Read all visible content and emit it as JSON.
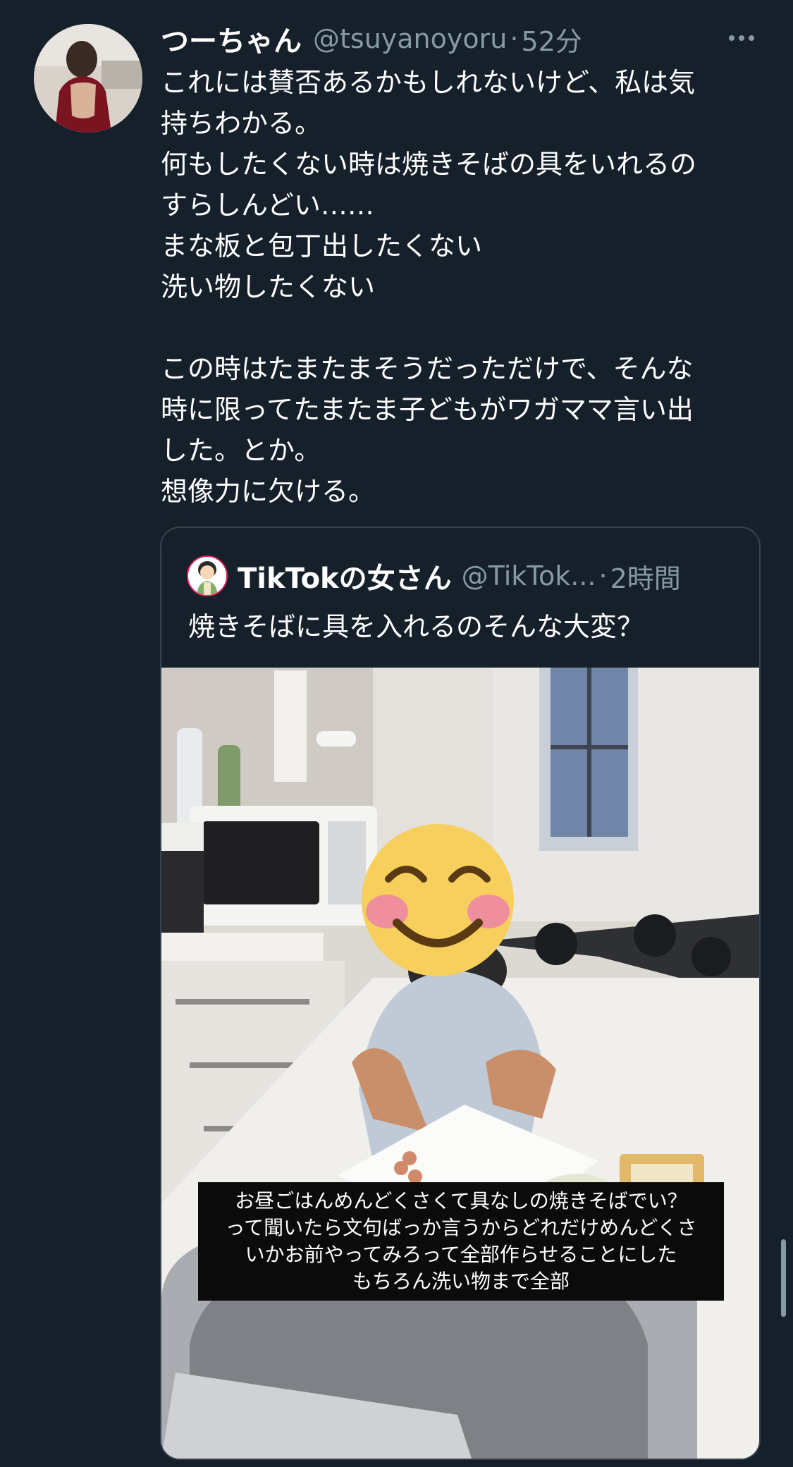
{
  "tweet": {
    "display_name": "つーちゃん",
    "handle": "@tsuyanoyoru",
    "separator": "·",
    "time": "52分",
    "body_lines": [
      "これには賛否あるかもしれないけど、私は気",
      "持ちわかる。",
      "何もしたくない時は焼きそばの具をいれるの",
      "すらしんどい……",
      "まな板と包丁出したくない",
      "洗い物したくない",
      "",
      "この時はたまたまそうだっただけで、そんな",
      "時に限ってたまたま子どもがワガママ言い出",
      "した。とか。",
      "想像力に欠ける。"
    ],
    "avatar_icon": "profile-photo",
    "more_icon": "more-horizontal-icon"
  },
  "quoted_tweet": {
    "display_name": "TikTokの女さん",
    "handle": "@TikTok...",
    "separator": "·",
    "time": "2時間",
    "text": "焼きそばに具を入れるのそんな大変？",
    "avatar_icon": "cartoon-woman-avatar",
    "media_caption_lines": [
      "お昼ごはんめんどくさくて具なしの焼きそばでい？",
      "って聞いたら文句ばっか言うからどれだけめんどくさ",
      "いかお前やってみろって全部作らせることにした",
      "もちろん洗い物まで全部"
    ],
    "media_icon": "kitchen-photo",
    "emoji_icon": "smiling-face-with-smiling-eyes"
  },
  "colors": {
    "background": "#15202b",
    "text": "#ffffff",
    "secondary_text": "#8899a6",
    "border": "#38444d"
  }
}
